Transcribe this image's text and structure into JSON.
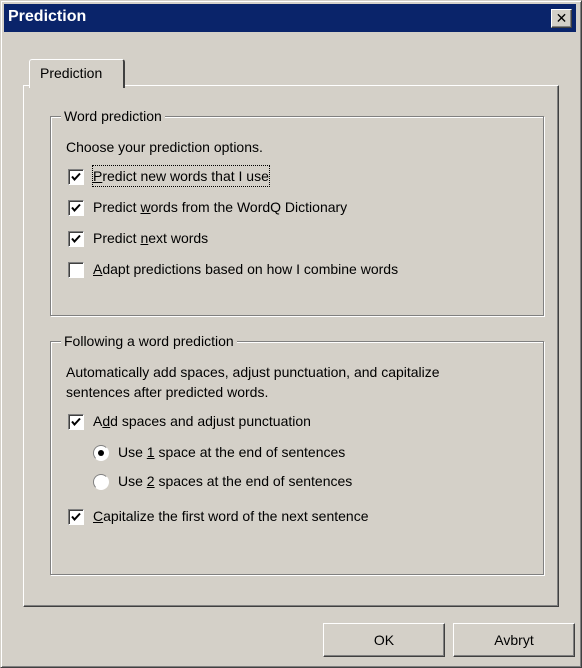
{
  "window": {
    "title": "Prediction",
    "close_glyph": "✕"
  },
  "tab": {
    "label": "Prediction"
  },
  "word_prediction": {
    "legend": "Word prediction",
    "intro": "Choose your prediction options.",
    "options": [
      {
        "pre": "",
        "key": "P",
        "post": "redict new words that I use",
        "checked": true
      },
      {
        "pre": "Predict ",
        "key": "w",
        "post": "ords from the WordQ Dictionary",
        "checked": true
      },
      {
        "pre": "Predict ",
        "key": "n",
        "post": "ext words",
        "checked": true
      },
      {
        "pre": "",
        "key": "A",
        "post": "dapt predictions based on how I combine words",
        "checked": false
      }
    ]
  },
  "following": {
    "legend": "Following a word prediction",
    "intro_line1": "Automatically add spaces, adjust punctuation, and capitalize",
    "intro_line2": "sentences after predicted words.",
    "add_spaces": {
      "pre": "A",
      "key": "d",
      "post": "d spaces and adjust punctuation",
      "checked": true
    },
    "radio1": {
      "pre": "Use ",
      "key": "1",
      "post": " space at the end of sentences",
      "selected": true
    },
    "radio2": {
      "pre": "Use ",
      "key": "2",
      "post": " spaces at the end of sentences",
      "selected": false
    },
    "capitalize": {
      "pre": "",
      "key": "C",
      "post": "apitalize the first word of the next sentence",
      "checked": true
    }
  },
  "buttons": {
    "ok": "OK",
    "cancel": "Avbryt"
  }
}
